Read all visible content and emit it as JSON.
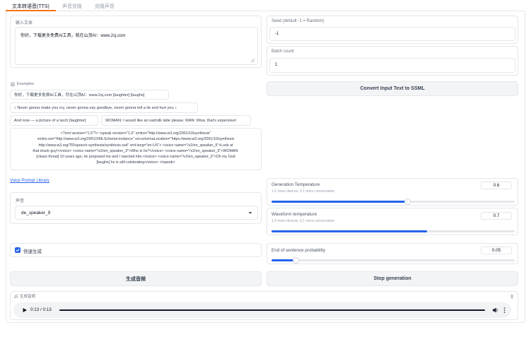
{
  "tabs": [
    {
      "label": "文本转语音(TTS)",
      "active": true
    },
    {
      "label": "声音克隆",
      "active": false
    },
    {
      "label": "克隆声音",
      "active": false
    }
  ],
  "input_text": {
    "label": "输入文本",
    "value": "你好，下载更多免费AI工具，就在山顶AI：www.2sj.com"
  },
  "seed": {
    "label": "Seed (default -1 = Random)",
    "value": "-1"
  },
  "batch": {
    "label": "Batch count",
    "value": "1"
  },
  "convert_button": "Convert Input Text to SSML",
  "examples": {
    "header": "Examples",
    "items": [
      "你好，下载更多免费AI工具，尽在山顶AI：www.2sj.com [laughter] [laughs]",
      "♪ Never gonna make you cry, never gonna say goodbye, never gonna tell a lie and hurt you ♪",
      "And now — a picture of a larch [laughter]",
      "WOMAN: I would like an oatmilk latte please. MAN: Wow, that's expensive!"
    ],
    "xml_line1": "<?xml version=\"1.0\"?> <speak version=\"1.0\" xmlns=\"http://www.w3.org/2001/10/synthesis\"",
    "xml_line2": "xmlns:xsi=\"http://www.w3.org/2001/XMLSchema-instance\" xsi:schemaLocation=\"https://www.w3.org/2001/10/synthesis",
    "xml_line3": "http://www.w3.org/TR/speech-synthesis/synthesis.xsd\" xml:lang=\"en-US\"> <voice name=\"/v2/en_speaker_9\">Look at",
    "xml_line4": "that drunk guy!</voice> <voice name=\"/v2/en_speaker_3\">Who is he?</voice> <voice name=\"/v2/en_speaker_9\">WOMAN:",
    "xml_line5": "[clears throat] 10 years ago, he proposed me and I rejected him.</voice> <voice name=\"/v2/en_speaker_3\">Oh my God",
    "xml_line6": "[laughs] he is still celebrating</voice> </speak>"
  },
  "voice_library_link": "Voice Prompt Library",
  "voice": {
    "label": "声音",
    "value": "de_speaker_9"
  },
  "gen_temp": {
    "title": "Generation Temperature",
    "info": "1.0 more diverse, 0.1 more conservative",
    "value": "0.6",
    "fraction": 0.56
  },
  "wave_temp": {
    "title": "Waveform temperature",
    "info": "1.0 more diverse, 0.1 more conservative",
    "value": "0.7",
    "fraction": 0.64
  },
  "eos": {
    "title": "End of sentence probability",
    "value": "0.05",
    "fraction": 0.1
  },
  "quick_gen": {
    "label": "快速生成",
    "checked": true
  },
  "generate_button": "生成音频",
  "stop_button": "Stop generation",
  "audio": {
    "label": "生成音频",
    "time": "0:13 / 0:13",
    "progress": 1.0
  },
  "colors": {
    "accent": "#2563eb",
    "tab_active": "#f97316"
  }
}
